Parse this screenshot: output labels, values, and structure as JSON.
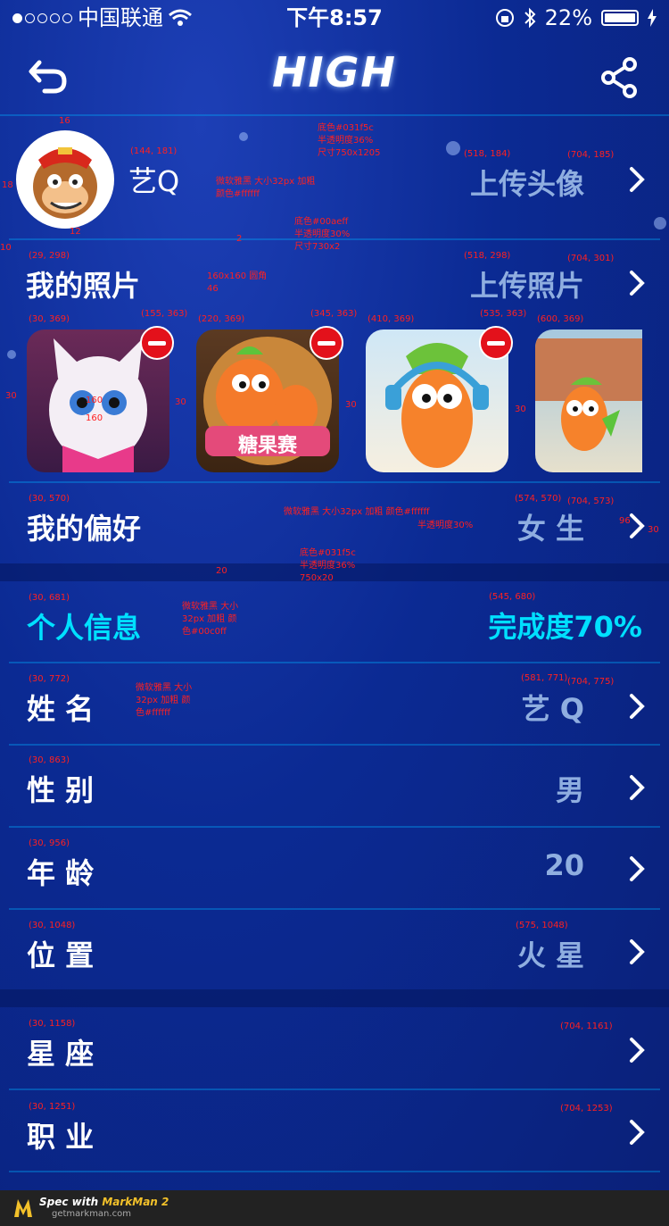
{
  "status_bar": {
    "carrier": "中国联通",
    "time": "下午8:57",
    "battery": "22%"
  },
  "header": {
    "title": "HIGH"
  },
  "profile": {
    "name": "艺Q",
    "upload_avatar": "上传头像"
  },
  "photos": {
    "label": "我的照片",
    "upload": "上传照片",
    "items": [
      {
        "name": "cat-photo",
        "caption": ""
      },
      {
        "name": "candy-photo",
        "caption": "糖果赛"
      },
      {
        "name": "carrot-headphones-photo",
        "caption": ""
      },
      {
        "name": "carrot-running-photo",
        "caption": ""
      }
    ]
  },
  "preference": {
    "label": "我的偏好",
    "value": "女 生"
  },
  "info": {
    "label": "个人信息",
    "completion": "完成度70%"
  },
  "fields": [
    {
      "label": "姓 名",
      "value": "艺 Q"
    },
    {
      "label": "性 别",
      "value": "男"
    },
    {
      "label": "年 龄",
      "value": "20"
    },
    {
      "label": "位 置",
      "value": "火 星"
    }
  ],
  "extra_fields": [
    {
      "label": "星 座",
      "value": ""
    },
    {
      "label": "职 业",
      "value": ""
    }
  ],
  "annotations": {
    "coords": [
      "(144, 181)",
      "(518, 184)",
      "(704, 185)",
      "(29, 298)",
      "(518, 298)",
      "(704, 301)",
      "(30, 369)",
      "(155, 363)",
      "(220, 369)",
      "(345, 363)",
      "(410, 369)",
      "(535, 363)",
      "(600, 369)",
      "(30, 570)",
      "(574, 570)",
      "(704, 573)",
      "(30, 681)",
      "(545, 680)",
      "(30, 772)",
      "(581, 771)",
      "(704, 775)",
      "(30, 863)",
      "(30, 956)",
      "(30, 1048)",
      "(575, 1048)",
      "(30, 1158)",
      "(704, 1161)",
      "(30, 1251)",
      "(704, 1253)"
    ],
    "measures": [
      "16",
      "18",
      "12",
      "10",
      "2",
      "160",
      "160",
      "30",
      "30",
      "30",
      "30",
      "96",
      "30",
      "20"
    ],
    "bg_note": [
      "底色#031f5c",
      "半透明度36%",
      "尺寸750x1205"
    ],
    "name_note": [
      "微软雅黑  大小32px  加粗",
      "颜色#ffffff"
    ],
    "line_note": [
      "底色#00aeff",
      "半透明度30%",
      "尺寸730x2"
    ],
    "photo_note": [
      "160x160  圆角",
      "46"
    ],
    "pref_note": [
      "微软雅黑  大小32px  加粗  颜色#ffffff",
      "半透明度30%"
    ],
    "band_note": [
      "底色#031f5c",
      "半透明度36%",
      "750x20"
    ],
    "info_note": [
      "微软雅黑  大小",
      "32px  加粗  颜",
      "色#00c0ff"
    ],
    "field_note": [
      "微软雅黑  大小",
      "32px  加粗  颜",
      "色#ffffff"
    ]
  },
  "footer": {
    "spec": "Spec with",
    "brand": "MarkMan 2",
    "url": "getmarkman.com"
  }
}
